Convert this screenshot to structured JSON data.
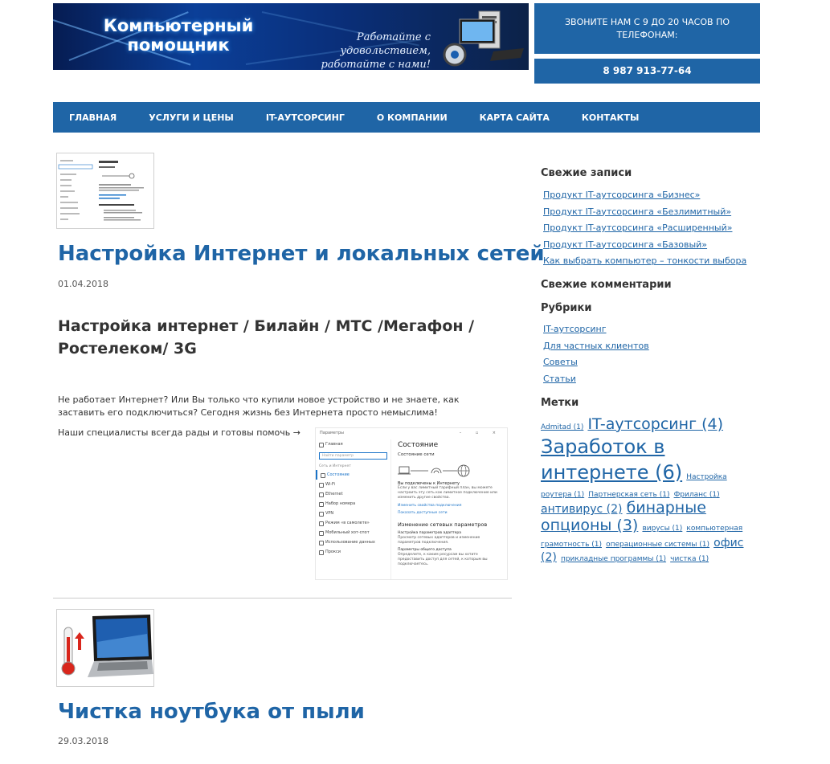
{
  "header": {
    "logo_line1": "Компьютерный",
    "logo_line2": "помощник",
    "slogan_line1": "Работайте с удовольствием,",
    "slogan_line2": "работайте с нами!",
    "hours_text": "ЗВОНИТЕ НАМ С 9 ДО 20 ЧАСОВ ПО ТЕЛЕФОНАМ:",
    "phone": "8 987 913-77-64"
  },
  "nav": {
    "items": [
      "ГЛАВНАЯ",
      "УСЛУГИ И ЦЕНЫ",
      "IT-АУТСОРСИНГ",
      "О КОМПАНИИ",
      "КАРТА САЙТА",
      "КОНТАКТЫ"
    ]
  },
  "posts": [
    {
      "title": "Настройка Интернет и локальных сетей",
      "date": "01.04.2018",
      "subheading": "Настройка интернет / Билайн / МТС /Мегафон / Ростелеком/ 3G",
      "paragraph": "Не работает Интернет? Или Вы только что купили новое устройство и не знаете, как заставить его подключиться? Сегодня жизнь без Интернета просто немыслима!",
      "more": "Наши специалисты всегда рады и готовы помочь →"
    },
    {
      "title": "Чистка ноутбука от пыли",
      "date": "29.03.2018"
    }
  ],
  "settings_mock": {
    "window_title": "Параметры",
    "home": "Главная",
    "search_placeholder": "Найти параметр",
    "section": "Сеть и Интернет",
    "menu": [
      "Состояние",
      "Wi-Fi",
      "Ethernet",
      "Набор номера",
      "VPN",
      "Режим «в самолете»",
      "Мобильный хот-спот",
      "Использование данных",
      "Прокси"
    ],
    "heading": "Состояние",
    "subheading": "Состояние сети",
    "connected": "Вы подключены к Интернету",
    "connected_desc": "Если у вас лимитный тарифный план, вы можете настроить эту сеть как лимитное подключение или изменить другие свойства.",
    "link1": "Изменить свойства подключения",
    "link2": "Показать доступные сети",
    "change_heading": "Изменение сетевых параметров",
    "opt1": "Настройка параметров адаптера",
    "opt1_desc": "Просмотр сетевых адаптеров и изменение параметров подключения.",
    "opt2": "Параметры общего доступа",
    "opt2_desc": "Определите, к каким ресурсам вы хотите предоставить доступ для сетей, к которым вы подключаетесь."
  },
  "sidebar": {
    "recent_posts_heading": "Свежие записи",
    "recent_posts": [
      "Продукт IT-аутсорсинга «Бизнес»",
      "Продукт IT-аутсорсинга «Безлимитный»",
      "Продукт IT-аутсорсинга «Расширенный»",
      "Продукт IT-аутсорсинга «Базовый»",
      "Как выбрать компьютер – тонкости выбора"
    ],
    "recent_comments_heading": "Свежие комментарии",
    "categories_heading": "Рубрики",
    "categories": [
      "IT-аутсорсинг",
      "Для частных клиентов",
      "Советы",
      "Статьи"
    ],
    "tags_heading": "Метки",
    "tags": [
      {
        "label": "Admitad (1)",
        "size": "xs"
      },
      {
        "label": "IT-аутсорсинг (4)",
        "size": "lg"
      },
      {
        "label": "Заработок в интернете (6)",
        "size": "xl"
      },
      {
        "label": "Настройка роутера (1)",
        "size": "xs"
      },
      {
        "label": "Партнерская сеть (1)",
        "size": "xs"
      },
      {
        "label": "Фриланс (1)",
        "size": "xs"
      },
      {
        "label": "антивирус (2)",
        "size": "md"
      },
      {
        "label": "бинарные опционы (3)",
        "size": "lg"
      },
      {
        "label": "вирусы (1)",
        "size": "xs"
      },
      {
        "label": "компьютерная грамотность (1)",
        "size": "xs"
      },
      {
        "label": "операционные системы (1)",
        "size": "xs"
      },
      {
        "label": "офис (2)",
        "size": "md"
      },
      {
        "label": "прикладные программы (1)",
        "size": "xs"
      },
      {
        "label": "чистка (1)",
        "size": "xs"
      }
    ]
  },
  "colors": {
    "brand_blue": "#1f65a6",
    "link_blue": "#1f65a6"
  }
}
